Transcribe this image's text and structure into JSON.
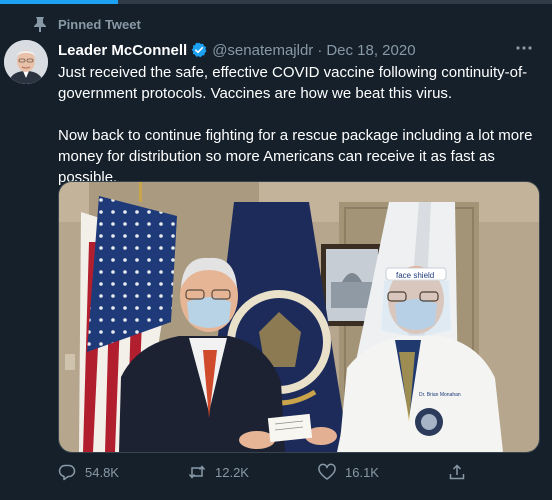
{
  "pinned": {
    "label": "Pinned Tweet",
    "icon": "pin-icon"
  },
  "author": {
    "name": "Leader McConnell",
    "handle": "@senatemajldr",
    "separator": "·",
    "date": "Dec 18, 2020",
    "verified_icon": "verified-badge-icon"
  },
  "tweet": {
    "paragraph1": "Just received the safe, effective COVID vaccine following continuity-of-government protocols. Vaccines are how we beat this virus.",
    "paragraph2": "Now back to continue fighting for a rescue package including a lot more money for distribution so more Americans can receive it as fast as possible."
  },
  "media": {
    "face_shield_text": "face shield",
    "coat_name": "Dr. Brian Monahan"
  },
  "actions": {
    "replies": "54.8K",
    "retweets": "12.2K",
    "likes": "16.1K"
  },
  "colors": {
    "background": "#15202b",
    "secondary_text": "#8899a6",
    "verified": "#1da1f2",
    "border": "#38444d"
  }
}
